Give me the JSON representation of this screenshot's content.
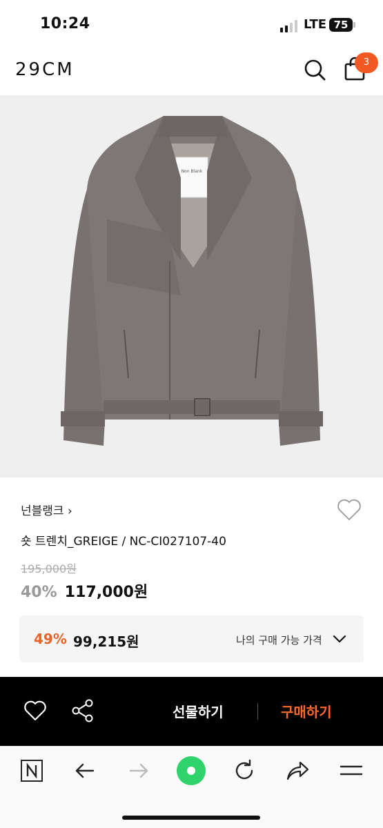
{
  "status_bar": {
    "time": "10:24",
    "network": "LTE",
    "battery": "75"
  },
  "header": {
    "logo": "29CM",
    "cart_count": "3",
    "icons": [
      "search-icon",
      "shopping-bag-icon"
    ]
  },
  "product": {
    "brand": "넌블랭크",
    "brand_chevron": "›",
    "name": "숏 트렌치_GREIGE / NC-CI027107-40",
    "original_price": "195,000원",
    "discount": "40%",
    "sale_price": "117,000원",
    "image_tag": "Non Blank"
  },
  "my_price": {
    "discount": "49%",
    "price": "99,215원",
    "label": "나의 구매 가능 가격"
  },
  "purchase_bar": {
    "gift_label": "선물하기",
    "buy_label": "구매하기",
    "buy_color": "#ff6a2c"
  },
  "browser_bar": {
    "icons": [
      "naver-n-icon",
      "back-arrow-icon",
      "forward-arrow-icon",
      "green-dot-icon",
      "reload-icon",
      "share-arrow-icon",
      "menu-icon"
    ]
  },
  "colors": {
    "accent": "#f05a22",
    "image_bg": "#efefef",
    "jacket": "#7b7673"
  }
}
